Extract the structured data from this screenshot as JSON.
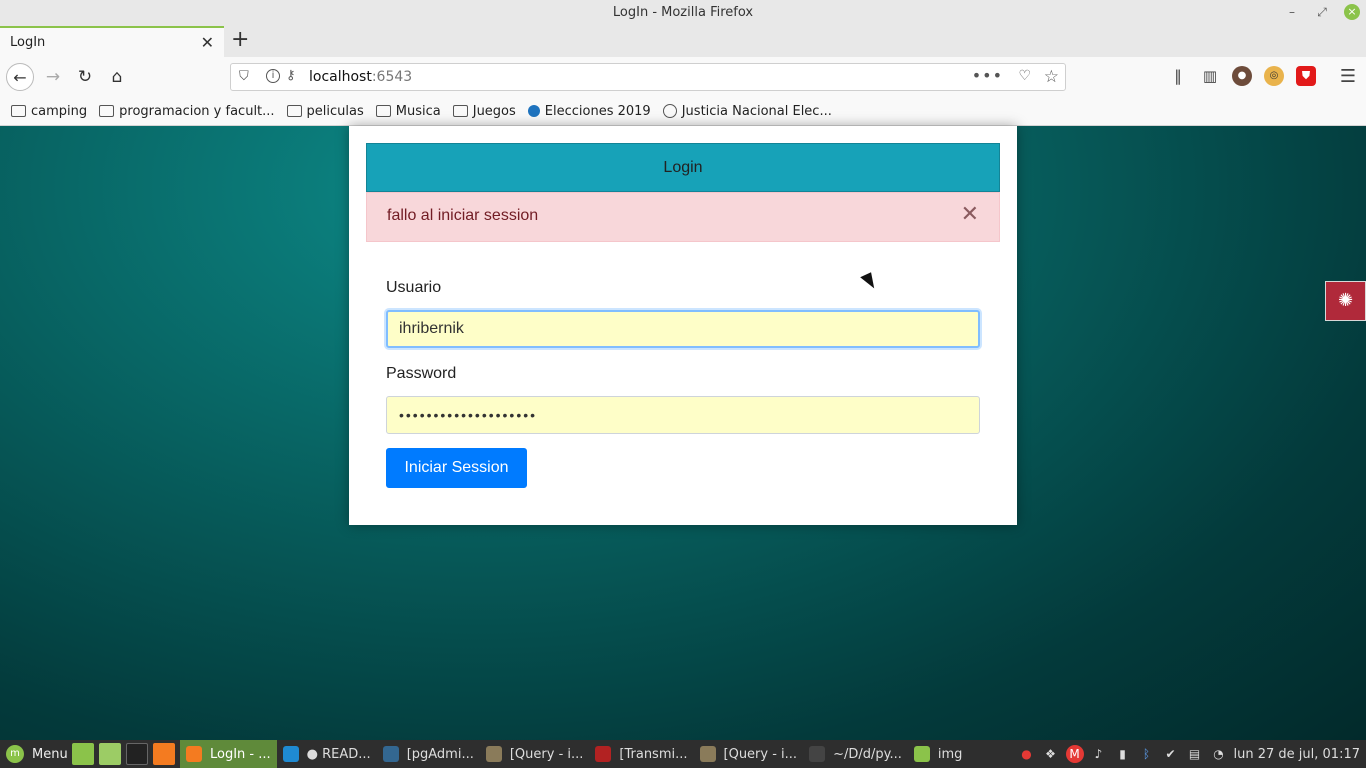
{
  "window": {
    "title": "LogIn - Mozilla Firefox",
    "minimize": "–",
    "maximize": "⤢",
    "close": "×"
  },
  "tabs": [
    {
      "title": "LogIn",
      "close": "✕"
    }
  ],
  "newtab": "+",
  "navbar": {
    "url_host": "localhost",
    "url_port": ":6543",
    "page_actions": "•••"
  },
  "bookmarks": [
    {
      "label": "camping",
      "icon": "folder-icon"
    },
    {
      "label": "programacion y facult...",
      "icon": "folder-icon"
    },
    {
      "label": "peliculas",
      "icon": "folder-icon"
    },
    {
      "label": "Musica",
      "icon": "folder-icon"
    },
    {
      "label": "Juegos",
      "icon": "folder-icon"
    },
    {
      "label": "Elecciones 2019",
      "icon": "site-icon"
    },
    {
      "label": "Justicia Nacional Elec...",
      "icon": "globe-icon"
    }
  ],
  "login": {
    "header": "Login",
    "alert_text": "fallo al iniciar session",
    "alert_close": "✕",
    "usuario_label": "Usuario",
    "usuario_value": "ihribernik",
    "password_label": "Password",
    "password_value": "••••••••••••••••••••",
    "submit_label": "Iniciar Session"
  },
  "taskbar": {
    "menu_label": "Menu",
    "items": [
      {
        "label": "LogIn - ...",
        "active": true,
        "icon_color": "#f47b20"
      },
      {
        "label": "● READ...",
        "active": false,
        "icon_color": "#1f8ad2"
      },
      {
        "label": "[pgAdmi...",
        "active": false,
        "icon_color": "#336791"
      },
      {
        "label": "[Query - i...",
        "active": false,
        "icon_color": "#8a7b5a"
      },
      {
        "label": "[Transmi...",
        "active": false,
        "icon_color": "#b22222"
      },
      {
        "label": "[Query - i...",
        "active": false,
        "icon_color": "#8a7b5a"
      },
      {
        "label": "~/D/d/py...",
        "active": false,
        "icon_color": "#444444"
      },
      {
        "label": "img",
        "active": false,
        "icon_color": "#8bc34a"
      }
    ],
    "clock": "lun 27 de jul, 01:17"
  },
  "colors": {
    "card_header": "#17a2b8",
    "alert_bg": "#f8d7da",
    "primary_button": "#007bff",
    "accent": "#8bc34a"
  }
}
